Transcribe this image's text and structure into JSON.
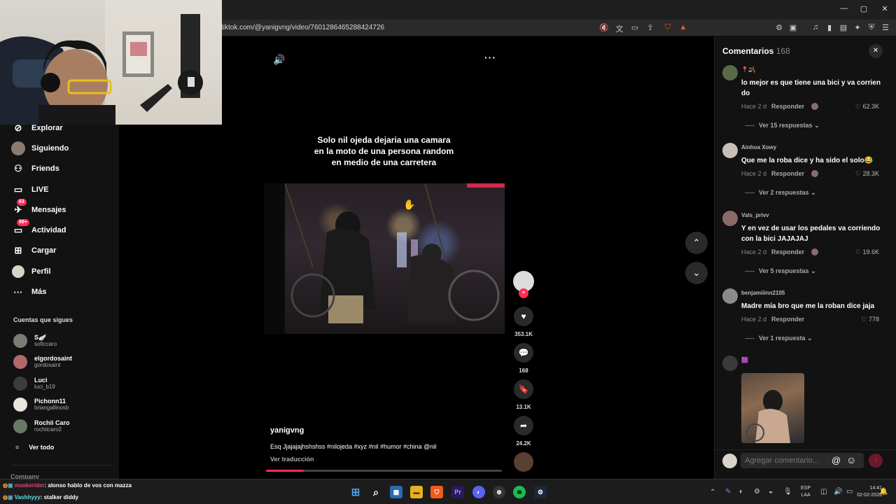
{
  "browser": {
    "url": "tiktok.com/@yanigvng/video/7601286465288424726",
    "controls": {
      "minimize": "—",
      "maximize": "▢",
      "close": "✕"
    }
  },
  "sidebar": {
    "nav": [
      {
        "label": "Explorar",
        "icon": "compass-icon",
        "glyph": "⊘"
      },
      {
        "label": "Siguiendo",
        "icon": "following-avatar-icon",
        "glyph": ""
      },
      {
        "label": "Friends",
        "icon": "friends-icon",
        "glyph": "👥"
      },
      {
        "label": "LIVE",
        "icon": "live-icon",
        "glyph": "▭"
      },
      {
        "label": "Mensajes",
        "icon": "messages-icon",
        "glyph": "✈",
        "badge": "63"
      },
      {
        "label": "Actividad",
        "icon": "activity-icon",
        "glyph": "▭",
        "badge": "99+"
      },
      {
        "label": "Cargar",
        "icon": "upload-icon",
        "glyph": "⊞"
      },
      {
        "label": "Perfil",
        "icon": "profile-avatar-icon",
        "glyph": ""
      },
      {
        "label": "Más",
        "icon": "more-icon",
        "glyph": "···"
      }
    ],
    "following_title": "Cuentas que sigues",
    "following": [
      {
        "name": "S🪽",
        "handle": "soficcaro"
      },
      {
        "name": "elgordosaint",
        "handle": "gordosaint"
      },
      {
        "name": "Luci",
        "handle": "luci_b19"
      },
      {
        "name": "Pichonn11",
        "handle": "briangallinosb"
      },
      {
        "name": "Rochii Caro",
        "handle": "rochiicaro2"
      }
    ],
    "see_all": "Ver todo",
    "company": "Company"
  },
  "video": {
    "overlay_text": "Solo nil ojeda dejaria una camara en la moto de una persona random en medio de una carretera",
    "author": "yanigvng",
    "caption": "Esq Jjajajajhshshss #nilojeda #xyz #nil #humor #china @nil",
    "translate": "Ver traducción",
    "progress": 0.16,
    "likes": "353.1K",
    "comments": "168",
    "saves": "13.1K",
    "shares": "24.2K"
  },
  "comments_panel": {
    "title": "Comentarios",
    "count": "168",
    "reply_label": "Responder",
    "items": [
      {
        "user": "📍🪃",
        "text": "lo mejor es que tiene una bici y va corrien do",
        "time": "Hace 2 d",
        "likes": "62.3K",
        "more": "Ver 15 respuestas"
      },
      {
        "user": "Ainhoa Xowy",
        "text": "Que me la roba dice y ha sido el solo😂",
        "time": "Hace 2 d",
        "likes": "28.3K",
        "more": "Ver 2 respuestas"
      },
      {
        "user": "Vals_privv",
        "text": "Y en vez de usar los pedales va corriendo con la bici JAJAJAJ",
        "time": "Hace 2 d",
        "likes": "19.6K",
        "more": "Ver 5 respuestas"
      },
      {
        "user": "benjamiiinn2105",
        "text": "Madre mía bro que me la roban dice jaja",
        "time": "Hace 2 d",
        "likes": "778",
        "more": "Ver 1 respuesta"
      },
      {
        "user": "🟪",
        "text": "",
        "time": "",
        "likes": "",
        "more": ""
      }
    ],
    "input_placeholder": "Agregar comentario..."
  },
  "chat": [
    {
      "user": "maskerider",
      "message": ": alonso hablo de vos con mazza",
      "color": "#e0457b"
    },
    {
      "user": "Vashhyyy",
      "message": ": stalker diddy",
      "color": "#5ce1e6"
    }
  ],
  "taskbar": {
    "language": "ESP",
    "layout": "LAA",
    "time": "14:41",
    "date": "02-02-2026"
  },
  "colors": {
    "accent": "#fe2c55",
    "panel": "#121212"
  }
}
